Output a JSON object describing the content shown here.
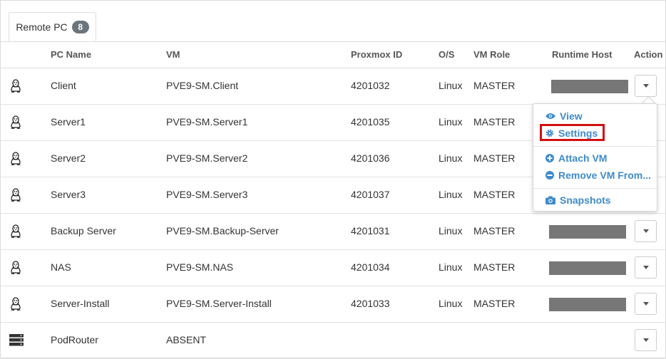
{
  "tabs": [
    {
      "label": "Remote PC",
      "count": "8"
    }
  ],
  "columns": {
    "pc_name": "PC Name",
    "vm": "VM",
    "proxmox_id": "Proxmox ID",
    "os": "O/S",
    "vm_role": "VM Role",
    "runtime_host": "Runtime Host",
    "action": "Action"
  },
  "rows": [
    {
      "icon": "linux-penguin-icon",
      "pc_name": "Client",
      "vm": "PVE9-SM.Client",
      "proxmox_id": "4201032",
      "os": "Linux",
      "vm_role": "MASTER",
      "runtime_host_redacted": true,
      "has_action": true
    },
    {
      "icon": "linux-penguin-icon",
      "pc_name": "Server1",
      "vm": "PVE9-SM.Server1",
      "proxmox_id": "4201035",
      "os": "Linux",
      "vm_role": "MASTER",
      "runtime_host_redacted": false,
      "has_action": false
    },
    {
      "icon": "linux-penguin-icon",
      "pc_name": "Server2",
      "vm": "PVE9-SM.Server2",
      "proxmox_id": "4201036",
      "os": "Linux",
      "vm_role": "MASTER",
      "runtime_host_redacted": false,
      "has_action": false
    },
    {
      "icon": "linux-penguin-icon",
      "pc_name": "Server3",
      "vm": "PVE9-SM.Server3",
      "proxmox_id": "4201037",
      "os": "Linux",
      "vm_role": "MASTER",
      "runtime_host_redacted": false,
      "has_action": false
    },
    {
      "icon": "linux-penguin-icon",
      "pc_name": "Backup Server",
      "vm": "PVE9-SM.Backup-Server",
      "proxmox_id": "4201031",
      "os": "Linux",
      "vm_role": "MASTER",
      "runtime_host_redacted": true,
      "has_action": true
    },
    {
      "icon": "linux-penguin-icon",
      "pc_name": "NAS",
      "vm": "PVE9-SM.NAS",
      "proxmox_id": "4201034",
      "os": "Linux",
      "vm_role": "MASTER",
      "runtime_host_redacted": true,
      "has_action": true
    },
    {
      "icon": "linux-penguin-icon",
      "pc_name": "Server-Install",
      "vm": "PVE9-SM.Server-Install",
      "proxmox_id": "4201033",
      "os": "Linux",
      "vm_role": "MASTER",
      "runtime_host_redacted": true,
      "has_action": true
    },
    {
      "icon": "server-rack-icon",
      "pc_name": "PodRouter",
      "vm": "ABSENT",
      "proxmox_id": "",
      "os": "",
      "vm_role": "",
      "runtime_host_redacted": false,
      "has_action": true
    }
  ],
  "action_menu": {
    "items": [
      {
        "icon": "eye-icon",
        "label": "View"
      },
      {
        "icon": "gear-icon",
        "label": "Settings",
        "highlighted": true
      },
      {
        "icon": "plus-circle-icon",
        "label": "Attach VM"
      },
      {
        "icon": "minus-circle-icon",
        "label": "Remove VM From..."
      },
      {
        "icon": "camera-icon",
        "label": "Snapshots"
      }
    ]
  },
  "colors": {
    "menu_link": "#3f8bc9",
    "highlight_border": "#d11010",
    "badge_bg": "#6c757d",
    "redaction": "#777777"
  }
}
